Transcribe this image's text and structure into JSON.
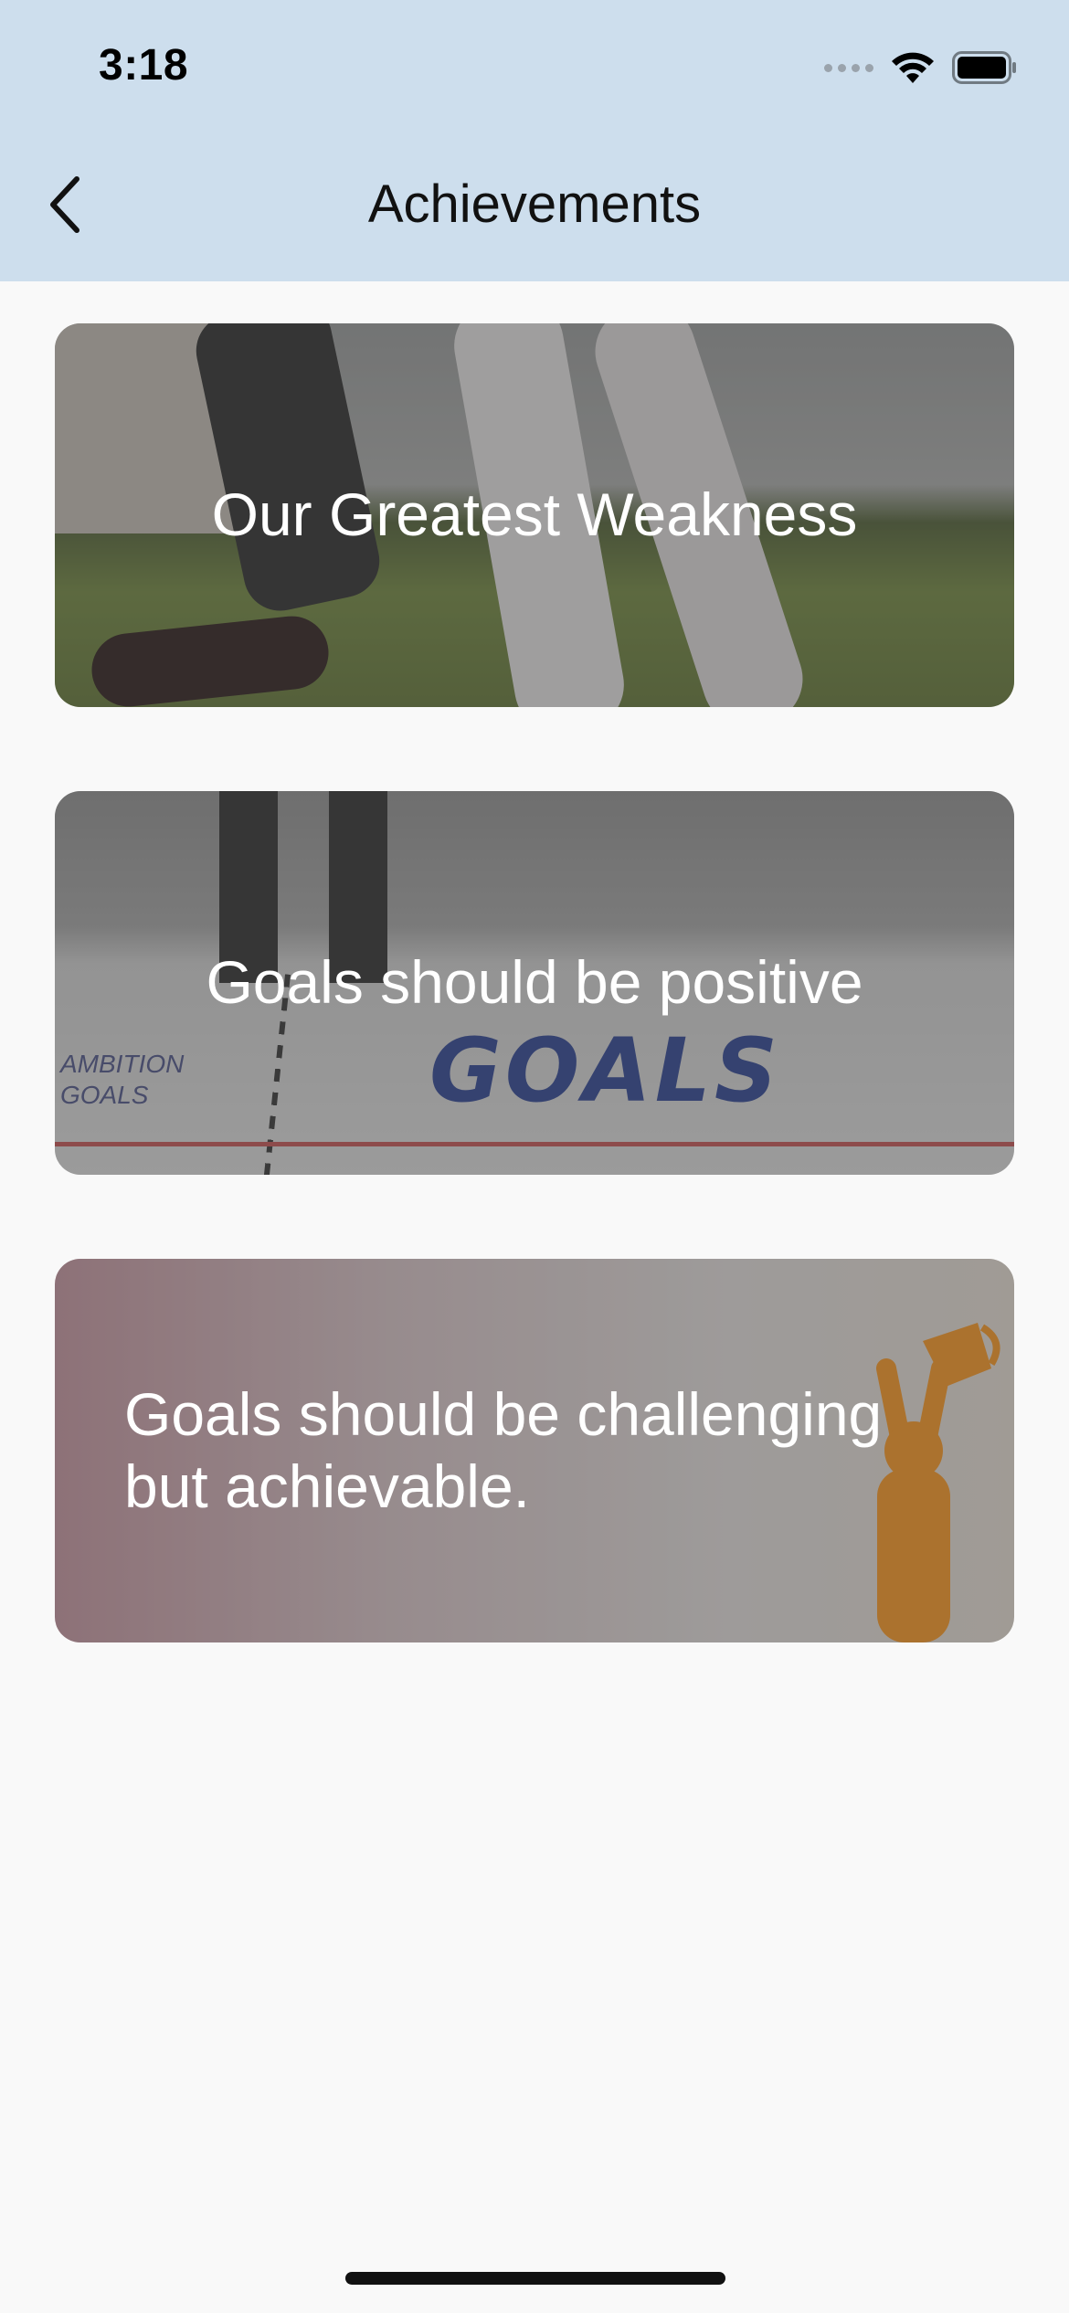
{
  "status_bar": {
    "time": "3:18",
    "icons": [
      "signal-icon",
      "wifi-icon",
      "battery-icon"
    ]
  },
  "nav": {
    "title": "Achievements",
    "back_icon": "chevron-left-icon",
    "background_color": "#cddeed"
  },
  "cards": [
    {
      "title": "Our Greatest Weakness",
      "image": "sprinter starting position on track"
    },
    {
      "title": "Goals should be positive",
      "image": "feet in front of GOALS written on paper"
    },
    {
      "title": "Goals should be challenging but achievable.",
      "image": "silhouette holding trophy"
    }
  ],
  "card2_image_text": {
    "goals_word": "GOALS"
  }
}
